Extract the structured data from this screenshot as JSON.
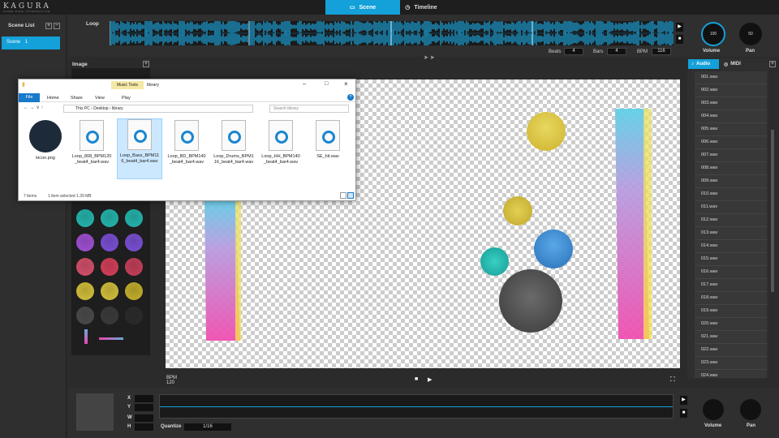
{
  "app": {
    "logo": "KAGURA",
    "logo_sub": "GAME SIDE INTERACTIVE"
  },
  "tabs": [
    {
      "label": "Scene",
      "active": true
    },
    {
      "label": "Timeline",
      "active": false
    }
  ],
  "scene_list": {
    "title": "Scene List",
    "add": "+",
    "remove": "−",
    "items": [
      {
        "label": "Scene",
        "number": "1"
      }
    ]
  },
  "loop": {
    "label": "Loop",
    "beats_label": "Beats",
    "beats_value": "4",
    "bars_label": "Bars",
    "bars_value": "4",
    "bpm_label": "BPM",
    "bpm_value": "116"
  },
  "knobs": {
    "volume_label": "Volume",
    "volume_value": "100",
    "pan_label": "Pan",
    "pan_value": "50"
  },
  "image_panel": {
    "title": "Image",
    "add": "+"
  },
  "audio_panel": {
    "audio_tab": "Audio",
    "midi_tab": "MIDI",
    "add": "+",
    "items": [
      "001.wav",
      "002.wav",
      "003.wav",
      "004.wav",
      "005.wav",
      "006.wav",
      "007.wav",
      "008.wav",
      "009.wav",
      "010.wav",
      "011.wav",
      "012.wav",
      "013.wav",
      "014.wav",
      "015.wav",
      "016.wav",
      "017.wav",
      "018.wav",
      "019.wav",
      "020.wav",
      "021.wav",
      "022.wav",
      "023.wav",
      "024.wav"
    ]
  },
  "canvas_footer": {
    "bpm_label": "BPM",
    "bpm_value": "120"
  },
  "bottom": {
    "x": "X",
    "y": "Y",
    "w": "W",
    "h": "H",
    "quantize_label": "Quantize",
    "quantize_value": "1/16",
    "volume_label": "Volume",
    "pan_label": "Pan"
  },
  "explorer": {
    "title": "library",
    "music_tools": "Music Tools",
    "ribbon": [
      "File",
      "Home",
      "Share",
      "View",
      "Play"
    ],
    "breadcrumb": [
      "This PC",
      "Desktop",
      "library"
    ],
    "search_placeholder": "Search library",
    "files": [
      {
        "name": "kicon.png"
      },
      {
        "name": "Loop_808_BPM120_beat4_bar4.wav"
      },
      {
        "name": "Loop_Bass_BPM116_beat4_bar4.wav",
        "selected": true
      },
      {
        "name": "Loop_BD_BPM140_beat4_bar4.wav"
      },
      {
        "name": "Loop_Drums_BPM116_beat4_bar4.wav"
      },
      {
        "name": "Loop_HH_BPM140_beat4_bar4.wav"
      },
      {
        "name": "SE_hit.wav"
      }
    ],
    "status_items": "7 items",
    "status_selected": "1 item selected  1.39 MB"
  },
  "colors": {
    "accent": "#14a0d8",
    "yellow": "#d6c23a",
    "teal": "#22b8b0",
    "blue": "#3d8fd6",
    "dark": "#4a4a4a",
    "pink": "#ec4fb0"
  }
}
